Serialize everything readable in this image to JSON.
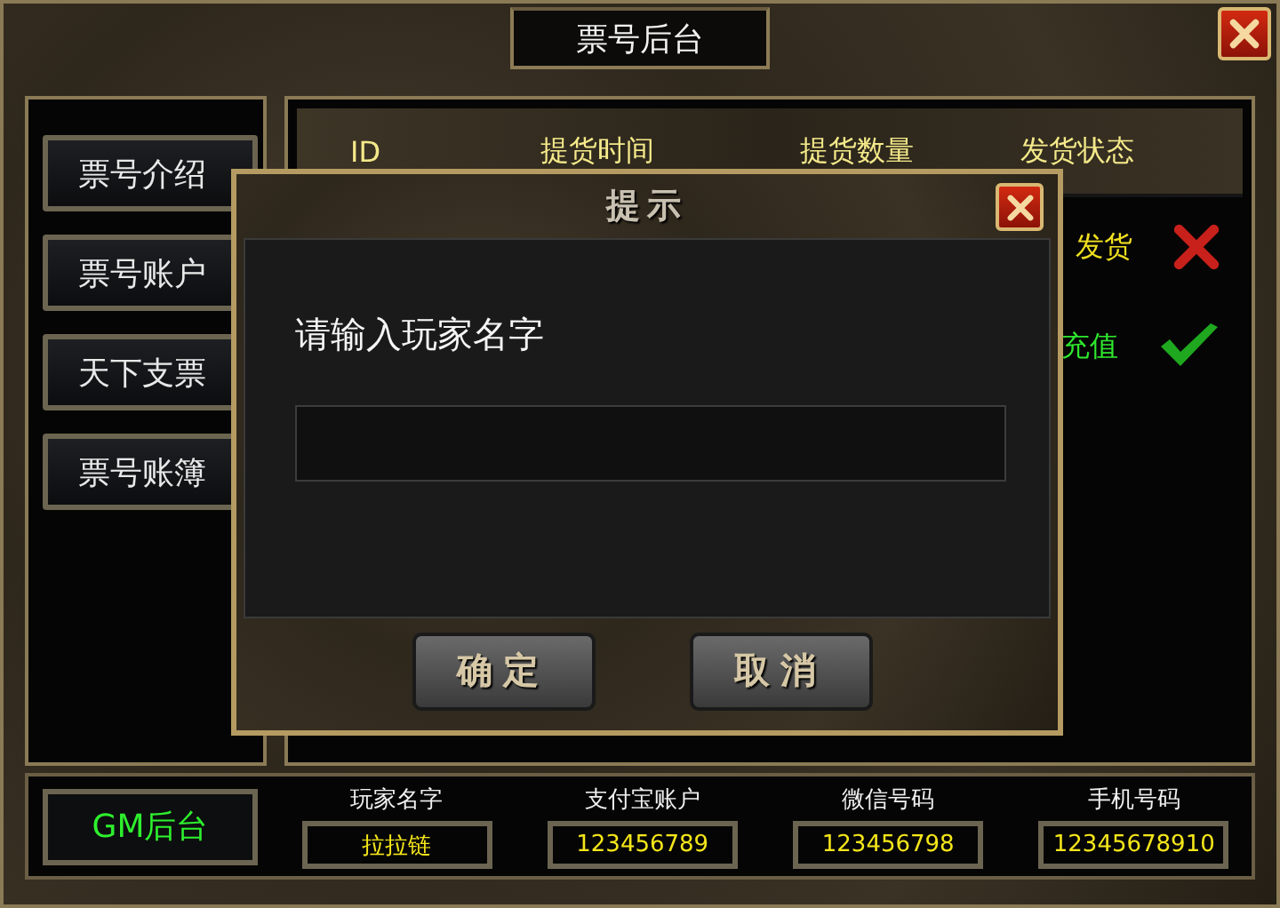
{
  "window": {
    "title": "票号后台"
  },
  "sidebar": {
    "items": [
      {
        "label": "票号介绍"
      },
      {
        "label": "票号账户"
      },
      {
        "label": "天下支票"
      },
      {
        "label": "票号账簿"
      }
    ]
  },
  "table": {
    "columns": [
      "ID",
      "提货时间",
      "提货数量",
      "发货状态"
    ],
    "rows": [
      {
        "status": "发货",
        "done": false
      },
      {
        "status": "充值",
        "done": true
      }
    ]
  },
  "footer": {
    "gm_button": "GM后台",
    "fields": [
      {
        "label": "玩家名字",
        "value": "拉拉链"
      },
      {
        "label": "支付宝账户",
        "value": "123456789"
      },
      {
        "label": "微信号码",
        "value": "123456798"
      },
      {
        "label": "手机号码",
        "value": "12345678910"
      }
    ]
  },
  "dialog": {
    "title": "提示",
    "prompt": "请输入玩家名字",
    "buttons": [
      "确定",
      "取消"
    ]
  }
}
